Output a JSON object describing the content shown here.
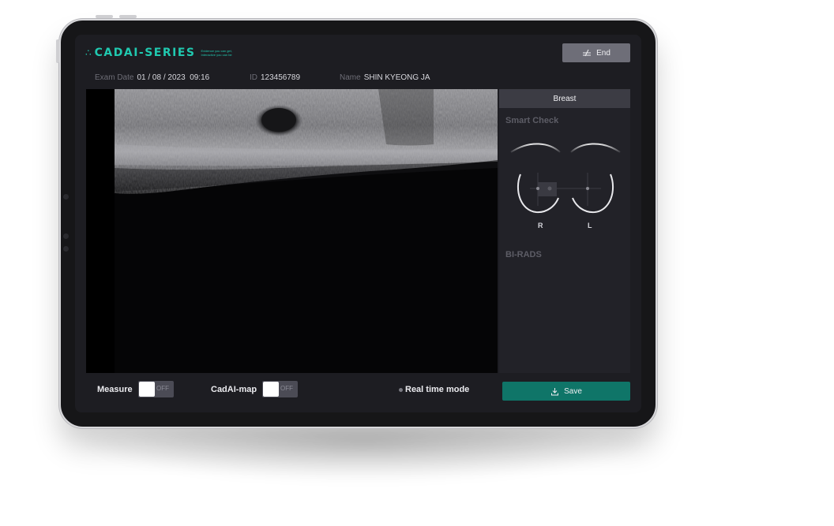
{
  "app": {
    "logo_text": "CADAI-SERIES",
    "tagline_line1": "Evidence you can get,",
    "tagline_line2": "Interactive you can be"
  },
  "header": {
    "end_label": "End",
    "exam_date_label": "Exam Date",
    "exam_date_value": "01 / 08 / 2023  09:16",
    "id_label": "ID",
    "id_value": "123456789",
    "name_label": "Name",
    "name_value": "SHIN KYEONG JA"
  },
  "side_panel": {
    "tab_label": "Breast",
    "smart_check_title": "Smart Check",
    "right_label": "R",
    "left_label": "L",
    "birads_title": "BI-RADS"
  },
  "bottom": {
    "measure_label": "Measure",
    "measure_state": "OFF",
    "cadai_map_label": "CadAI-map",
    "cadai_map_state": "OFF",
    "realtime_label": "Real time mode",
    "save_label": "Save"
  },
  "colors": {
    "accent": "#20c9b0",
    "save_button": "#0f7568",
    "end_button": "#6e6e78"
  }
}
